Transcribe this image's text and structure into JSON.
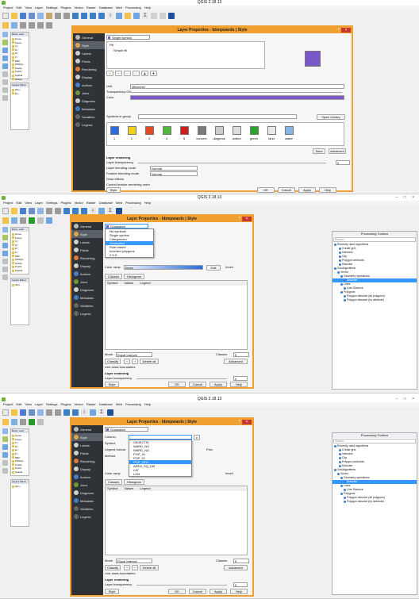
{
  "app": {
    "title": "QGIS 2.18.13",
    "menus": [
      "Project",
      "Edit",
      "View",
      "Layer",
      "Settings",
      "Plugins",
      "Vector",
      "Raster",
      "Database",
      "Web",
      "Processing",
      "Help"
    ]
  },
  "docks": {
    "browser_title": "Brow...anel",
    "layers_title": "Layers Panel",
    "browser_items": [
      "Home",
      "Favou",
      "C:/",
      "D:/",
      "E:/",
      "F:/",
      "DB2",
      "MSSQL",
      "Oracle",
      "PostG",
      "Spatial",
      "ArcGe",
      "ArcGe",
      "OWS",
      "Tile Se"
    ],
    "layer_items": [
      "bbm...",
      "lbs..."
    ]
  },
  "toolbox": {
    "title": "Processing Toolbox",
    "search_placeholder": "Search...",
    "items": [
      "Recently used algorithms",
      "Create grid",
      "Intersect",
      "Clip",
      "Polygon centroids",
      "Dissolve",
      "GeoAlgorithms",
      "Vector",
      "Geometry operations",
      "Dissolve",
      "Lines",
      "Line Dissolve",
      "Polygons",
      "Polygon dissolve (all polygons)",
      "Polygon dissolve (by attribute)"
    ]
  },
  "dialog": {
    "title1": "Layer Properties - bbmpwards | Style",
    "title2": "Layer Properties - bbmpwards | Style",
    "title3": "Layer Properties - bbmpwards | Style",
    "help": "?",
    "close": "×",
    "nav": [
      "General",
      "Style",
      "Labels",
      "Fields",
      "Rendering",
      "Display",
      "Actions",
      "Joins",
      "Diagrams",
      "Metadata",
      "Variables",
      "Legend"
    ]
  },
  "panel1": {
    "renderer": "Single symbol",
    "tree_fill": "Fill",
    "tree_simple": "Simple fill",
    "unit_label": "Unit",
    "unit_value": "Millimeter",
    "transparency_label": "Transparency 0%",
    "color_label": "Color",
    "symbols_in_group_label": "Symbols in group",
    "open_library": "Open Library",
    "library": [
      {
        "name": "1",
        "color": "#2b6de0"
      },
      {
        "name": "2",
        "color": "#f0d21a"
      },
      {
        "name": "3",
        "color": "#e24a22"
      },
      {
        "name": "4",
        "color": "#4fb73a"
      },
      {
        "name": "5",
        "color": "#ce1f1f"
      },
      {
        "name": "corners",
        "color": "#7a7a7a"
      },
      {
        "name": "diagonal",
        "color": "#cccccc"
      },
      {
        "name": "dotted",
        "color": "#dddddd"
      },
      {
        "name": "green",
        "color": "#2aa52a"
      },
      {
        "name": "land",
        "color": "#e8e8e8"
      },
      {
        "name": "water",
        "color": "#89b4e6"
      }
    ],
    "save": "Save",
    "advanced": "Advanced",
    "layer_rendering": "Layer rendering",
    "layer_transparency": "Layer transparency",
    "transparency_value": "0",
    "layer_blending_label": "Layer blending mode",
    "layer_blending_value": "Normal",
    "feature_blending_label": "Feature blending mode",
    "feature_blending_value": "Normal",
    "draw_effects": "Draw effects",
    "control_order": "Control feature rendering order",
    "style": "Style",
    "ok": "OK",
    "cancel": "Cancel",
    "apply": "Apply",
    "help": "Help"
  },
  "panel2": {
    "renderer": "Graduated",
    "options": [
      "No symbols",
      "Single symbol",
      "Categorized",
      "Graduated",
      "Rule-based",
      "Inverted polygons",
      "2.5 D"
    ],
    "selected": "Graduated",
    "color_ramp_label": "Color ramp",
    "color_ramp_value": "Blues",
    "edit": "Edit",
    "invert": "Invert",
    "tab_classes": "Classes",
    "tab_histogram": "Histogram",
    "col_symbol": "Symbol",
    "col_values": "Values",
    "col_legend": "Legend",
    "mode_label": "Mode",
    "mode_value": "Equal Interval",
    "classes_label": "Classes",
    "classes_value": "5",
    "classify": "Classify",
    "delete_all": "Delete all",
    "advanced": "Advanced",
    "link_boundaries": "Link class boundaries",
    "layer_rendering": "Layer rendering",
    "layer_transparency": "Layer transparency",
    "transparency_value": "0",
    "style": "Style",
    "ok": "OK",
    "cancel": "Cancel",
    "apply": "Apply",
    "help": "Help"
  },
  "panel3": {
    "renderer": "Graduated",
    "column_label": "Column",
    "symbol_label": "Symbol",
    "legend_format_label": "Legend format",
    "method_label": "Method",
    "color_ramp_label": "Color ramp",
    "columns": [
      "OBJECTID",
      "WARD_NO",
      "WARD_NA",
      "POP_91",
      "POP_01",
      "POP_2011",
      "AREA_SQ_KM",
      "LAT",
      "LON"
    ],
    "selected_column": "POP_2011",
    "precision": "Prec",
    "invert": "Invert",
    "tab_classes": "Classes",
    "tab_histogram": "Histogram",
    "col_symbol": "Symbol",
    "col_values": "Values",
    "col_legend": "Legend",
    "mode_label": "Mode",
    "mode_value": "Equal Interval",
    "classes_label": "Classes",
    "classes_value": "5",
    "classify": "Classify",
    "delete_all": "Delete all",
    "advanced": "Advanced",
    "link_boundaries": "Link class boundaries",
    "layer_rendering": "Layer rendering",
    "layer_transparency": "Layer transparency",
    "transparency_value": "0",
    "style": "Style",
    "ok": "OK",
    "cancel": "Cancel",
    "apply": "Apply",
    "help": "Help"
  },
  "colors": {
    "dialog_border": "#f0a030",
    "nav_bg": "#2f3338",
    "selection": "#3399ff",
    "fill_swatch": "#7a57c9",
    "blues_ramp": "#2b6de0"
  }
}
